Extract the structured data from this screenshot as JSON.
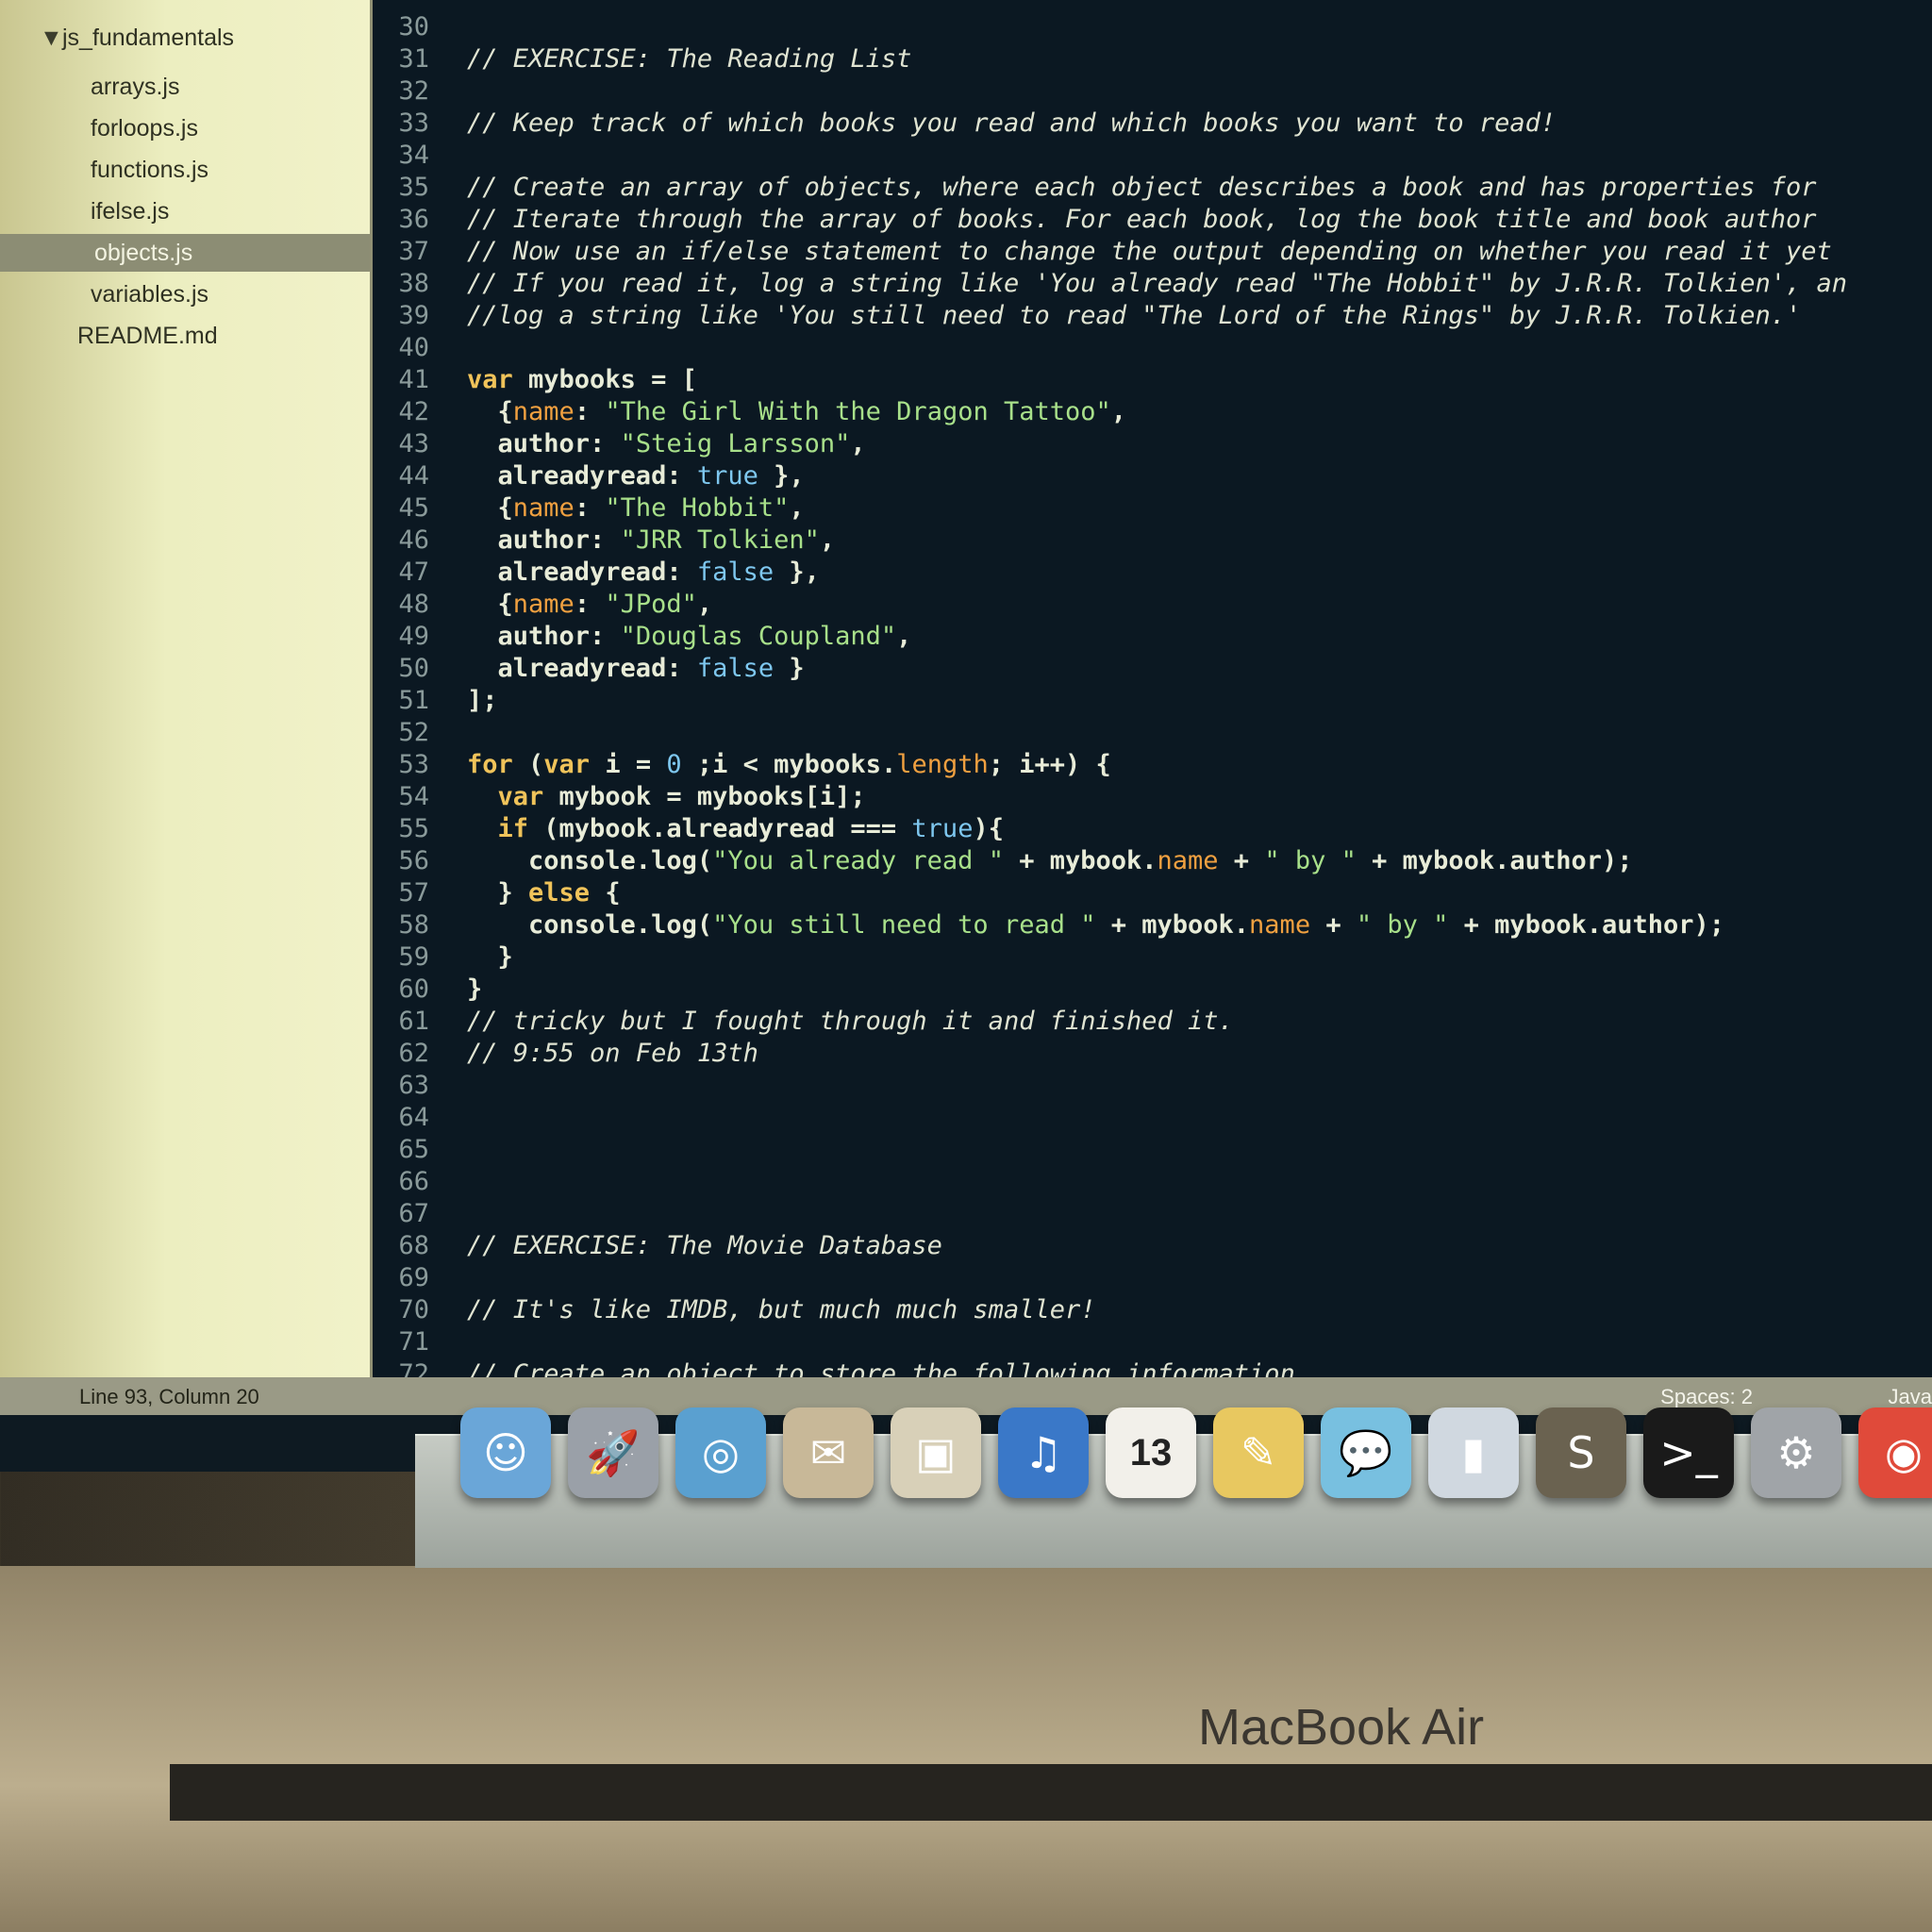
{
  "sidebar": {
    "folder": "js_fundamentals",
    "files": [
      {
        "name": "arrays.js",
        "selected": false
      },
      {
        "name": "forloops.js",
        "selected": false
      },
      {
        "name": "functions.js",
        "selected": false
      },
      {
        "name": "ifelse.js",
        "selected": false
      },
      {
        "name": "objects.js",
        "selected": true
      },
      {
        "name": "variables.js",
        "selected": false
      },
      {
        "name": "README.md",
        "selected": false
      }
    ]
  },
  "editor": {
    "lines": [
      {
        "n": "30",
        "t": ""
      },
      {
        "n": "31",
        "t": "// EXERCISE: The Reading List"
      },
      {
        "n": "32",
        "t": ""
      },
      {
        "n": "33",
        "t": "// Keep track of which books you read and which books you want to read!"
      },
      {
        "n": "34",
        "t": ""
      },
      {
        "n": "35",
        "t": "// Create an array of objects, where each object describes a book and has properties for"
      },
      {
        "n": "36",
        "t": "// Iterate through the array of books. For each book, log the book title and book author"
      },
      {
        "n": "37",
        "t": "// Now use an if/else statement to change the output depending on whether you read it yet"
      },
      {
        "n": "38",
        "t": "// If you read it, log a string like 'You already read \"The Hobbit\" by J.R.R. Tolkien', an"
      },
      {
        "n": "39",
        "t": "//log a string like 'You still need to read \"The Lord of the Rings\" by J.R.R. Tolkien.'"
      },
      {
        "n": "40",
        "t": ""
      },
      {
        "n": "41",
        "t": "var mybooks = ["
      },
      {
        "n": "42",
        "t": "  {name: \"The Girl With the Dragon Tattoo\","
      },
      {
        "n": "43",
        "t": "  author: \"Steig Larsson\","
      },
      {
        "n": "44",
        "t": "  alreadyread: true },"
      },
      {
        "n": "45",
        "t": "  {name: \"The Hobbit\","
      },
      {
        "n": "46",
        "t": "  author: \"JRR Tolkien\","
      },
      {
        "n": "47",
        "t": "  alreadyread: false },"
      },
      {
        "n": "48",
        "t": "  {name: \"JPod\","
      },
      {
        "n": "49",
        "t": "  author: \"Douglas Coupland\","
      },
      {
        "n": "50",
        "t": "  alreadyread: false }"
      },
      {
        "n": "51",
        "t": "];"
      },
      {
        "n": "52",
        "t": ""
      },
      {
        "n": "53",
        "t": "for (var i = 0 ;i < mybooks.length; i++) {"
      },
      {
        "n": "54",
        "t": "  var mybook = mybooks[i];"
      },
      {
        "n": "55",
        "t": "  if (mybook.alreadyread === true){"
      },
      {
        "n": "56",
        "t": "    console.log(\"You already read \" + mybook.name + \" by \" + mybook.author);"
      },
      {
        "n": "57",
        "t": "  } else {"
      },
      {
        "n": "58",
        "t": "    console.log(\"You still need to read \" + mybook.name + \" by \" + mybook.author);"
      },
      {
        "n": "59",
        "t": "  }"
      },
      {
        "n": "60",
        "t": "}"
      },
      {
        "n": "61",
        "t": "// tricky but I fought through it and finished it."
      },
      {
        "n": "62",
        "t": "// 9:55 on Feb 13th"
      },
      {
        "n": "63",
        "t": ""
      },
      {
        "n": "64",
        "t": ""
      },
      {
        "n": "65",
        "t": ""
      },
      {
        "n": "66",
        "t": ""
      },
      {
        "n": "67",
        "t": ""
      },
      {
        "n": "68",
        "t": "// EXERCISE: The Movie Database"
      },
      {
        "n": "69",
        "t": ""
      },
      {
        "n": "70",
        "t": "// It's like IMDB, but much much smaller!"
      },
      {
        "n": "71",
        "t": ""
      },
      {
        "n": "72",
        "t": "// Create an object to store the following information"
      }
    ]
  },
  "status": {
    "position": "Line 93, Column 20",
    "spaces": "Spaces: 2",
    "language": "Java"
  },
  "dock": {
    "apps": [
      {
        "name": "Finder",
        "icon": "finder-icon",
        "color": "#6aa6d8",
        "glyph": "☺"
      },
      {
        "name": "Launchpad",
        "icon": "rocket-icon",
        "color": "#9aa0a8",
        "glyph": "🚀"
      },
      {
        "name": "Safari",
        "icon": "compass-icon",
        "color": "#5aa0d0",
        "glyph": "◎"
      },
      {
        "name": "Mail",
        "icon": "stamp-icon",
        "color": "#c8b898",
        "glyph": "✉"
      },
      {
        "name": "Preview",
        "icon": "photos-icon",
        "color": "#d8d0b8",
        "glyph": "▣"
      },
      {
        "name": "iTunes",
        "icon": "music-note-icon",
        "color": "#3a78c8",
        "glyph": "♫"
      },
      {
        "name": "Calendar",
        "icon": "calendar-icon",
        "color": "#f2f0ea",
        "glyph": "13"
      },
      {
        "name": "Notes",
        "icon": "pencil-icon",
        "color": "#e8c860",
        "glyph": "✎"
      },
      {
        "name": "Messages",
        "icon": "chat-bubble-icon",
        "color": "#78c0e0",
        "glyph": "💬"
      },
      {
        "name": "Numbers",
        "icon": "bar-chart-icon",
        "color": "#d0d8e0",
        "glyph": "▮"
      },
      {
        "name": "Sublime Text",
        "icon": "sublime-icon",
        "color": "#6a6250",
        "glyph": "S"
      },
      {
        "name": "Terminal",
        "icon": "terminal-icon",
        "color": "#1a1a1a",
        "glyph": ">_"
      },
      {
        "name": "System Preferences",
        "icon": "gear-icon",
        "color": "#a0a4a8",
        "glyph": "⚙"
      },
      {
        "name": "Chrome",
        "icon": "chrome-icon",
        "color": "#e04a3a",
        "glyph": "◉"
      }
    ]
  },
  "device": {
    "brand": "MacBook Air"
  }
}
